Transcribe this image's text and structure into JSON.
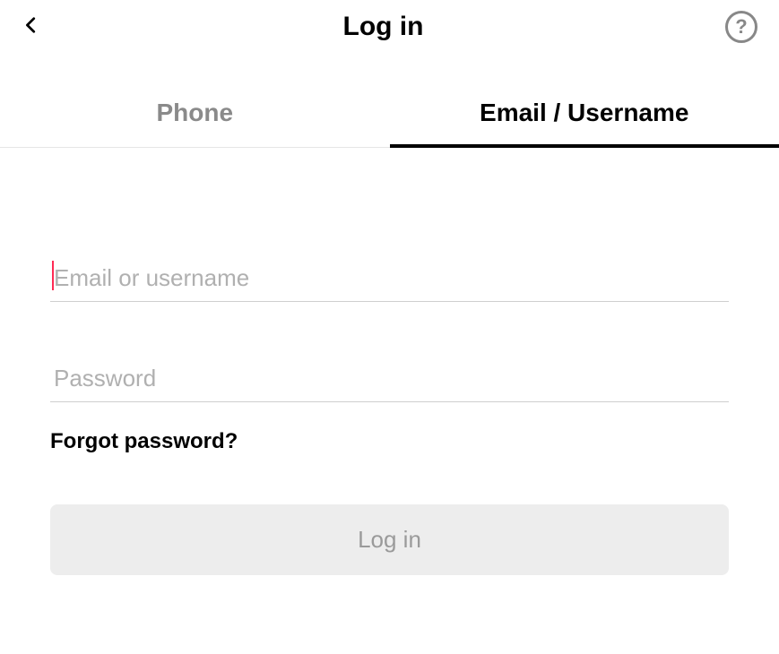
{
  "header": {
    "title": "Log in"
  },
  "tabs": {
    "phone_label": "Phone",
    "email_label": "Email / Username",
    "active": "email"
  },
  "form": {
    "email_placeholder": "Email or username",
    "email_value": "",
    "password_placeholder": "Password",
    "password_value": "",
    "forgot_label": "Forgot password?",
    "login_button_label": "Log in"
  },
  "icons": {
    "back": "chevron-left-icon",
    "help": "help-icon"
  }
}
